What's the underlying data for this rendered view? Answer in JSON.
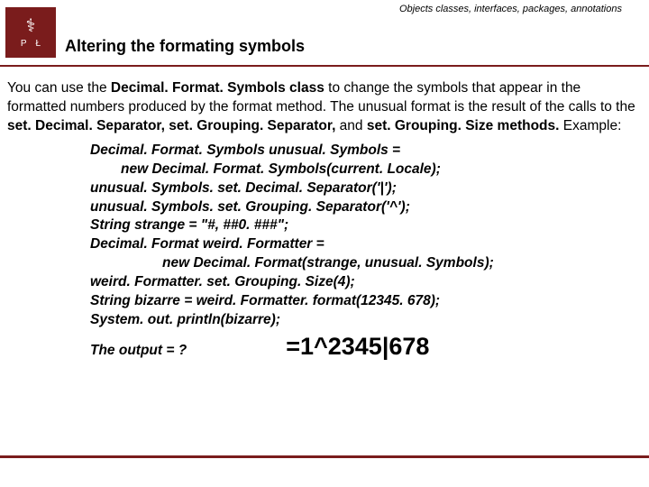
{
  "header": {
    "subtitle": "Objects classes, interfaces, packages, annotations",
    "title": "Altering the formating symbols",
    "logo": {
      "letter1": "P",
      "letter2": "Ł",
      "emblem": "⚕"
    }
  },
  "intro": {
    "t1": "You can use the ",
    "b1": "Decimal. Format. Symbols class",
    "t2": " to change the symbols that appear in the formatted numbers produced by the format method.  The unusual format is the result of the calls to the ",
    "b2": "set. Decimal. Separator, set. Grouping. Separator,",
    "t3": " and ",
    "b3": "set. Grouping. Size methods.",
    "t4": " Example:"
  },
  "code": {
    "l1": "Decimal. Format. Symbols unusual. Symbols =",
    "l2": "new Decimal. Format. Symbols(current. Locale);",
    "l3": "unusual. Symbols. set. Decimal. Separator('|');",
    "l4": "unusual. Symbols. set. Grouping. Separator('^');",
    "l5": "String strange = \"#, ##0. ###\";",
    "l6": "Decimal. Format weird. Formatter =",
    "l7": "new Decimal. Format(strange, unusual. Symbols);",
    "l8": "weird. Formatter. set. Grouping. Size(4);",
    "l9": "String bizarre = weird. Formatter. format(12345. 678);",
    "l10": "System. out. println(bizarre);",
    "out_label": "The output = ?",
    "out_value": "=1^2345|678"
  }
}
